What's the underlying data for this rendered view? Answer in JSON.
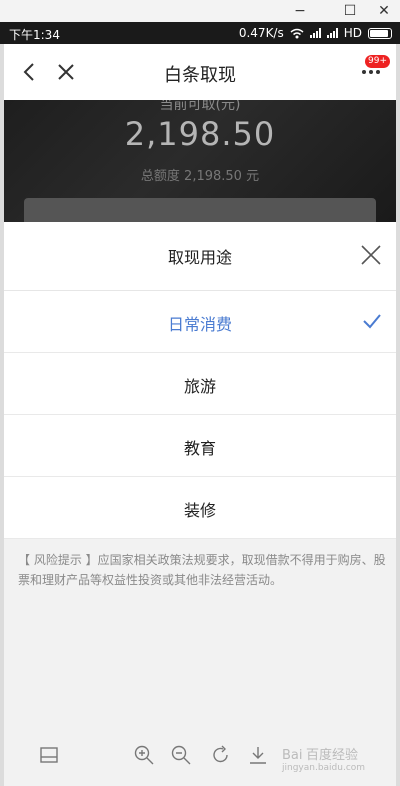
{
  "status_bar": {
    "time": "下午1:34",
    "speed": "0.47K/s",
    "network": "HD"
  },
  "nav": {
    "title": "白条取现",
    "badge": "99+"
  },
  "summary": {
    "available_label": "当前可取(元)",
    "amount": "2,198.50",
    "total": "总额度 2,198.50 元"
  },
  "sheet": {
    "title": "取现用途",
    "options": [
      {
        "label": "日常消费",
        "selected": true
      },
      {
        "label": "旅游",
        "selected": false
      },
      {
        "label": "教育",
        "selected": false
      },
      {
        "label": "装修",
        "selected": false
      }
    ],
    "risk_notice": "【 风险提示 】应国家相关政策法规要求，取现借款不得用于购房、股票和理财产品等权益性投资或其他非法经营活动。"
  },
  "watermark": {
    "brand": "Bai",
    "name": "百度经验",
    "url": "jingyan.baidu.com"
  },
  "colors": {
    "accent": "#4a7bd1",
    "badge": "#e22222"
  }
}
